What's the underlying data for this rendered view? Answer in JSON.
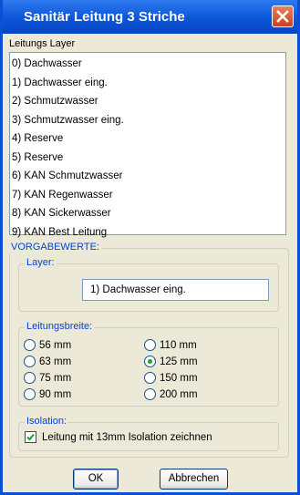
{
  "window": {
    "title": "Sanitär Leitung 3 Striche"
  },
  "layers": {
    "label": "Leitungs Layer",
    "items": [
      "0) Dachwasser",
      "1) Dachwasser eing.",
      "2) Schmutzwasser",
      "3) Schmutzwasser eing.",
      "4) Reserve",
      "5) Reserve",
      "6) KAN Schmutzwasser",
      "7) KAN Regenwasser",
      "8) KAN Sickerwasser",
      "9) KAN Best Leitung"
    ]
  },
  "vorgabe": {
    "title": "VORGABEWERTE:",
    "layer": {
      "title": "Layer:",
      "value": "1) Dachwasser eing."
    },
    "breite": {
      "title": "Leitungsbreite:",
      "options": [
        "56 mm",
        "63 mm",
        "75 mm",
        "90 mm",
        "110 mm",
        "125 mm",
        "150 mm",
        "200 mm"
      ],
      "selected": "125 mm"
    },
    "isolation": {
      "title": "Isolation:",
      "checkbox_label": "Leitung mit 13mm Isolation zeichnen",
      "checked": true
    }
  },
  "buttons": {
    "ok": "OK",
    "cancel": "Abbrechen"
  },
  "colors": {
    "titlebar": "#0a56d8",
    "group_title": "#0046d5",
    "radio_selected": "#21a121",
    "close_button": "#d45a34"
  }
}
